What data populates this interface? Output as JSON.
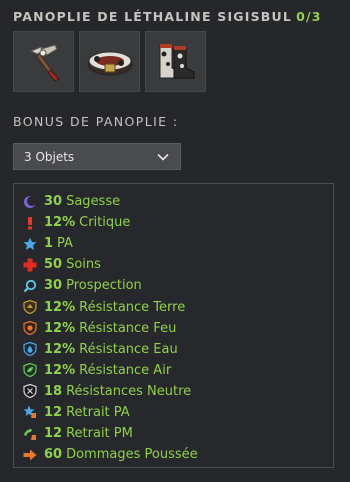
{
  "panoply": {
    "title": "PANOPLIE DE LÉTHALINE SIGISBUL",
    "count": "0/3"
  },
  "items": [
    {
      "name": "weapon-item",
      "icon": "pickaxe-icon"
    },
    {
      "name": "belt-item",
      "icon": "belt-icon"
    },
    {
      "name": "boots-item",
      "icon": "boots-icon"
    }
  ],
  "bonus": {
    "title": "BONUS DE PANOPLIE :",
    "selected": "3 Objets",
    "stats": [
      {
        "icon": "wisdom-icon",
        "value": "30",
        "label": "Sagesse"
      },
      {
        "icon": "critical-icon",
        "value": "12%",
        "label": "Critique"
      },
      {
        "icon": "ap-star-icon",
        "value": "1",
        "label": "PA"
      },
      {
        "icon": "heal-cross-icon",
        "value": "50",
        "label": "Soins"
      },
      {
        "icon": "prospecting-icon",
        "value": "30",
        "label": "Prospection"
      },
      {
        "icon": "earth-resistance-icon",
        "value": "12%",
        "label": "Résistance Terre"
      },
      {
        "icon": "fire-resistance-icon",
        "value": "12%",
        "label": "Résistance Feu"
      },
      {
        "icon": "water-resistance-icon",
        "value": "12%",
        "label": "Résistance Eau"
      },
      {
        "icon": "air-resistance-icon",
        "value": "12%",
        "label": "Résistance Air"
      },
      {
        "icon": "neutral-resistance-icon",
        "value": "18",
        "label": "Résistances Neutre"
      },
      {
        "icon": "ap-reduction-icon",
        "value": "12",
        "label": "Retrait PA"
      },
      {
        "icon": "mp-reduction-icon",
        "value": "12",
        "label": "Retrait PM"
      },
      {
        "icon": "pushback-icon",
        "value": "60",
        "label": "Dommages Poussée"
      }
    ]
  }
}
